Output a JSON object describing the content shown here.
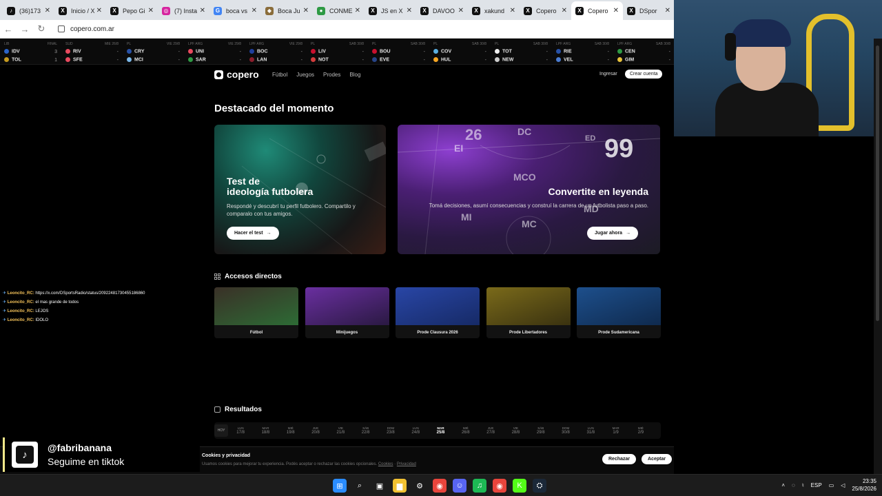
{
  "tabs": [
    {
      "label": "(36)173",
      "icon": "tiktok-icon",
      "color": "#111111",
      "glyph": "♪"
    },
    {
      "label": "Inicio / X",
      "icon": "x-icon",
      "color": "#111111",
      "glyph": "X"
    },
    {
      "label": "Pepo Gi",
      "icon": "x-icon",
      "color": "#111111",
      "glyph": "X"
    },
    {
      "label": "(7) Insta",
      "icon": "instagram-icon",
      "color": "#d6249f",
      "glyph": "◎"
    },
    {
      "label": "boca vs",
      "icon": "google-icon",
      "color": "#4285f4",
      "glyph": "G"
    },
    {
      "label": "Boca Ju",
      "icon": "boca-icon",
      "color": "#8a6d3b",
      "glyph": "◆"
    },
    {
      "label": "CONME",
      "icon": "conmebol-icon",
      "color": "#2e9a44",
      "glyph": "●"
    },
    {
      "label": "JS en X",
      "icon": "x-icon",
      "color": "#111111",
      "glyph": "X"
    },
    {
      "label": "DAVOO",
      "icon": "x-icon",
      "color": "#111111",
      "glyph": "X"
    },
    {
      "label": "xakund",
      "icon": "x-icon",
      "color": "#111111",
      "glyph": "X"
    },
    {
      "label": "Copero",
      "icon": "x-icon",
      "color": "#111111",
      "glyph": "X"
    },
    {
      "label": "Copero",
      "icon": "x-icon",
      "color": "#111111",
      "glyph": "X",
      "active": true
    },
    {
      "label": "DSpor",
      "icon": "x-icon",
      "color": "#111111",
      "glyph": "X"
    }
  ],
  "address": {
    "url": "copero.com.ar"
  },
  "ticker": [
    {
      "league": "LIB",
      "status": "FINAL",
      "home": "IDV",
      "away": "TOL",
      "hs": "3",
      "as": "1",
      "hc": "#2b63c7",
      "ac": "#c69a1f"
    },
    {
      "league": "SUD",
      "status": "MIE 26/8",
      "home": "RIV",
      "away": "SFE",
      "hs": "-",
      "as": "-",
      "hc": "#e84a5f",
      "ac": "#e84a5f"
    },
    {
      "league": "PL",
      "status": "VIE 29/8",
      "home": "CRY",
      "away": "MCI",
      "hs": "-",
      "as": "-",
      "hc": "#2852a8",
      "ac": "#7ab7e8"
    },
    {
      "league": "LPF ARG",
      "status": "VIE 29/8",
      "home": "UNI",
      "away": "SAR",
      "hs": "-",
      "as": "-",
      "hc": "#e84a5f",
      "ac": "#2e9a44"
    },
    {
      "league": "LPF ARG",
      "status": "VIE 29/8",
      "home": "BOC",
      "away": "LAN",
      "hs": "-",
      "as": "-",
      "hc": "#1f3f9e",
      "ac": "#8b1e2c"
    },
    {
      "league": "PL",
      "status": "SAB 30/8",
      "home": "LIV",
      "away": "NOT",
      "hs": "-",
      "as": "-",
      "hc": "#c8102e",
      "ac": "#d33c3c"
    },
    {
      "league": "PL",
      "status": "SAB 30/8",
      "home": "BOU",
      "away": "EVE",
      "hs": "-",
      "as": "-",
      "hc": "#c8102e",
      "ac": "#274488"
    },
    {
      "league": "PL",
      "status": "SAB 30/8",
      "home": "COV",
      "away": "HUL",
      "hs": "-",
      "as": "-",
      "hc": "#5aaee0",
      "ac": "#f5a623"
    },
    {
      "league": "PL",
      "status": "SAB 30/8",
      "home": "TOT",
      "away": "NEW",
      "hs": "-",
      "as": "-",
      "hc": "#eeeeee",
      "ac": "#cccccc"
    },
    {
      "league": "LPF ARG",
      "status": "SAB 30/8",
      "home": "RIE",
      "away": "VEL",
      "hs": "-",
      "as": "-",
      "hc": "#2852a8",
      "ac": "#4a7bd0"
    },
    {
      "league": "LPF ARG",
      "status": "SAB 30/8",
      "home": "CEN",
      "away": "GIM",
      "hs": "-",
      "as": "-",
      "hc": "#2e9a44",
      "ac": "#e8c23a"
    }
  ],
  "site": {
    "brand": "copero",
    "nav": [
      "Fútbol",
      "Juegos",
      "Prodes",
      "Blog"
    ],
    "login": "Ingresar",
    "signup": "Crear cuenta"
  },
  "featured": {
    "title": "Destacado del momento",
    "card_a": {
      "title_line1": "Test de",
      "title_line2": "ideología futbolera",
      "desc": "Respondé y descubrí tu perfil futbolero. Compartilo y comparalo con tus amigos.",
      "cta": "Hacer el test"
    },
    "card_b": {
      "title": "Convertite en leyenda",
      "desc": "Tomá decisiones, asumí consecuencias y construí la carrera de un futbolista paso a paso.",
      "cta": "Jugar ahora",
      "positions": [
        "DC",
        "EI",
        "ED",
        "MCO",
        "MI",
        "MD",
        "MC",
        "26",
        "99"
      ]
    }
  },
  "quick_access": {
    "title": "Accesos directos",
    "items": [
      {
        "label": "Fútbol",
        "c1": "#3a3027",
        "c2": "#2d6b35"
      },
      {
        "label": "Minijuegos",
        "c1": "#6a2fa0",
        "c2": "#2a1942"
      },
      {
        "label": "Prode Clausura 2026",
        "c1": "#2946a6",
        "c2": "#162a66"
      },
      {
        "label": "Prode Libertadores",
        "c1": "#7a6a1a",
        "c2": "#3a3210"
      },
      {
        "label": "Prode Sudamericana",
        "c1": "#1d4f8c",
        "c2": "#0f2a4e"
      }
    ]
  },
  "chat": [
    {
      "user": "Leoncito_RC:",
      "msg": "https://x.com/DSportsRadio/status/20922481730455186860"
    },
    {
      "user": "Leoncito_RC:",
      "msg": "el mas grande de todos"
    },
    {
      "user": "Leoncito_RC:",
      "msg": "LEJOS"
    },
    {
      "user": "Leoncito_RC:",
      "msg": "IDOLO"
    }
  ],
  "results": {
    "title": "Resultados",
    "today": "HOY",
    "days": [
      {
        "d": "LUN",
        "n": "17/8"
      },
      {
        "d": "MAR",
        "n": "18/8"
      },
      {
        "d": "MIÉ",
        "n": "19/8"
      },
      {
        "d": "JUE",
        "n": "20/8"
      },
      {
        "d": "VIE",
        "n": "21/8"
      },
      {
        "d": "SÁB",
        "n": "22/8"
      },
      {
        "d": "DOM",
        "n": "23/8"
      },
      {
        "d": "LUN",
        "n": "24/8"
      },
      {
        "d": "MAR",
        "n": "25/8",
        "active": true
      },
      {
        "d": "MIÉ",
        "n": "26/8"
      },
      {
        "d": "JUE",
        "n": "27/8"
      },
      {
        "d": "VIE",
        "n": "28/8"
      },
      {
        "d": "SÁB",
        "n": "29/8"
      },
      {
        "d": "DOM",
        "n": "30/8"
      },
      {
        "d": "LUN",
        "n": "31/8"
      },
      {
        "d": "MAR",
        "n": "1/9"
      },
      {
        "d": "MIÉ",
        "n": "2/9"
      }
    ]
  },
  "cookies": {
    "title": "Cookies y privacidad",
    "desc": "Usamos cookies para mejorar tu experiencia. Podés aceptar o rechazar las cookies opcionales.",
    "link1": "Cookies",
    "link2": "Privacidad",
    "reject": "Rechazar",
    "accept": "Aceptar"
  },
  "tiktok": {
    "handle": "@fabribanana",
    "subtitle": "Seguime en tiktok"
  },
  "taskbar": {
    "apps": [
      {
        "name": "windows-start-icon",
        "color": "#2a8cff",
        "glyph": "⊞"
      },
      {
        "name": "search-icon",
        "color": "transparent",
        "glyph": "⌕"
      },
      {
        "name": "task-view-icon",
        "color": "transparent",
        "glyph": "▣"
      },
      {
        "name": "file-explorer-icon",
        "color": "#f2c232",
        "glyph": "▆"
      },
      {
        "name": "settings-icon",
        "color": "transparent",
        "glyph": "⚙"
      },
      {
        "name": "chrome-icon",
        "color": "#e8453c",
        "glyph": "◉"
      },
      {
        "name": "discord-icon",
        "color": "#5865f2",
        "glyph": "☺"
      },
      {
        "name": "spotify-icon",
        "color": "#1db954",
        "glyph": "♫"
      },
      {
        "name": "chrome-profile-icon",
        "color": "#e8453c",
        "glyph": "◉"
      },
      {
        "name": "kick-icon",
        "color": "#53fc18",
        "glyph": "K"
      },
      {
        "name": "steam-icon",
        "color": "#1b2838",
        "glyph": "⛭"
      }
    ],
    "lang": "ESP",
    "time": "23:35",
    "date": "25/8/2026"
  }
}
